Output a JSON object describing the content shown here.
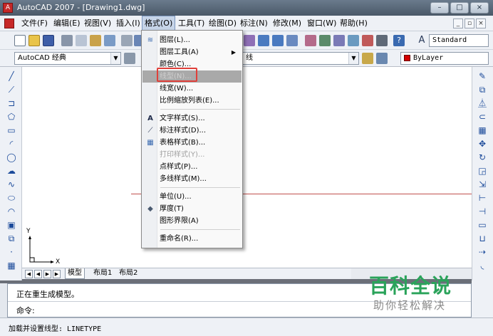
{
  "window": {
    "title": "AutoCAD 2007 - [Drawing1.dwg]",
    "buttons": [
      "–",
      "□",
      "×"
    ]
  },
  "menubar": {
    "items": [
      "文件(F)",
      "编辑(E)",
      "视图(V)",
      "插入(I)",
      "格式(O)",
      "工具(T)",
      "绘图(D)",
      "标注(N)",
      "修改(M)",
      "窗口(W)",
      "帮助(H)"
    ],
    "active": "格式(O)",
    "mdi_buttons": [
      "_",
      "▫",
      "×"
    ]
  },
  "toolbar1": {
    "text_style_value": "Standard"
  },
  "toolbar2": {
    "workspace_value": "AutoCAD 经典",
    "linetype_fragment": "线",
    "color_value": "ByLayer",
    "color_swatch": "#d40000"
  },
  "format_menu": {
    "items": [
      {
        "label": "图层(L)...",
        "icon": "layers-icon",
        "disabled": false
      },
      {
        "label": "图层工具(A)",
        "icon": "",
        "submenu": true,
        "disabled": false
      },
      {
        "label": "颜色(C)...",
        "icon": "",
        "disabled": false
      },
      {
        "label": "线型(N)...",
        "icon": "",
        "disabled": false,
        "highlighted": true
      },
      {
        "label": "线宽(W)...",
        "icon": "",
        "disabled": false
      },
      {
        "label": "比例缩放列表(E)...",
        "icon": "",
        "disabled": false
      },
      {
        "label": "文字样式(S)...",
        "icon": "text-style-icon",
        "disabled": false
      },
      {
        "label": "标注样式(D)...",
        "icon": "dim-style-icon",
        "disabled": false
      },
      {
        "label": "表格样式(B)...",
        "icon": "table-style-icon",
        "disabled": false
      },
      {
        "label": "打印样式(Y)...",
        "icon": "",
        "disabled": true
      },
      {
        "label": "点样式(P)...",
        "icon": "",
        "disabled": false
      },
      {
        "label": "多线样式(M)...",
        "icon": "",
        "disabled": false
      },
      {
        "label": "单位(U)...",
        "icon": "",
        "disabled": false
      },
      {
        "label": "厚度(T)",
        "icon": "thickness-icon",
        "disabled": false
      },
      {
        "label": "图形界限(A)",
        "icon": "",
        "disabled": false
      },
      {
        "label": "重命名(R)...",
        "icon": "",
        "disabled": false
      }
    ]
  },
  "canvas": {
    "axis_y": "Y",
    "axis_x": "X"
  },
  "layout_tabs": {
    "items": [
      "模型",
      "布局1",
      "布局2"
    ],
    "active": "模型"
  },
  "command": {
    "line1": "正在重生成模型。",
    "prompt": "命令:"
  },
  "status": {
    "text": "加载并设置线型:  LINETYPE"
  },
  "watermark": {
    "main": "百科全说",
    "sub": "助你轻松解决"
  }
}
